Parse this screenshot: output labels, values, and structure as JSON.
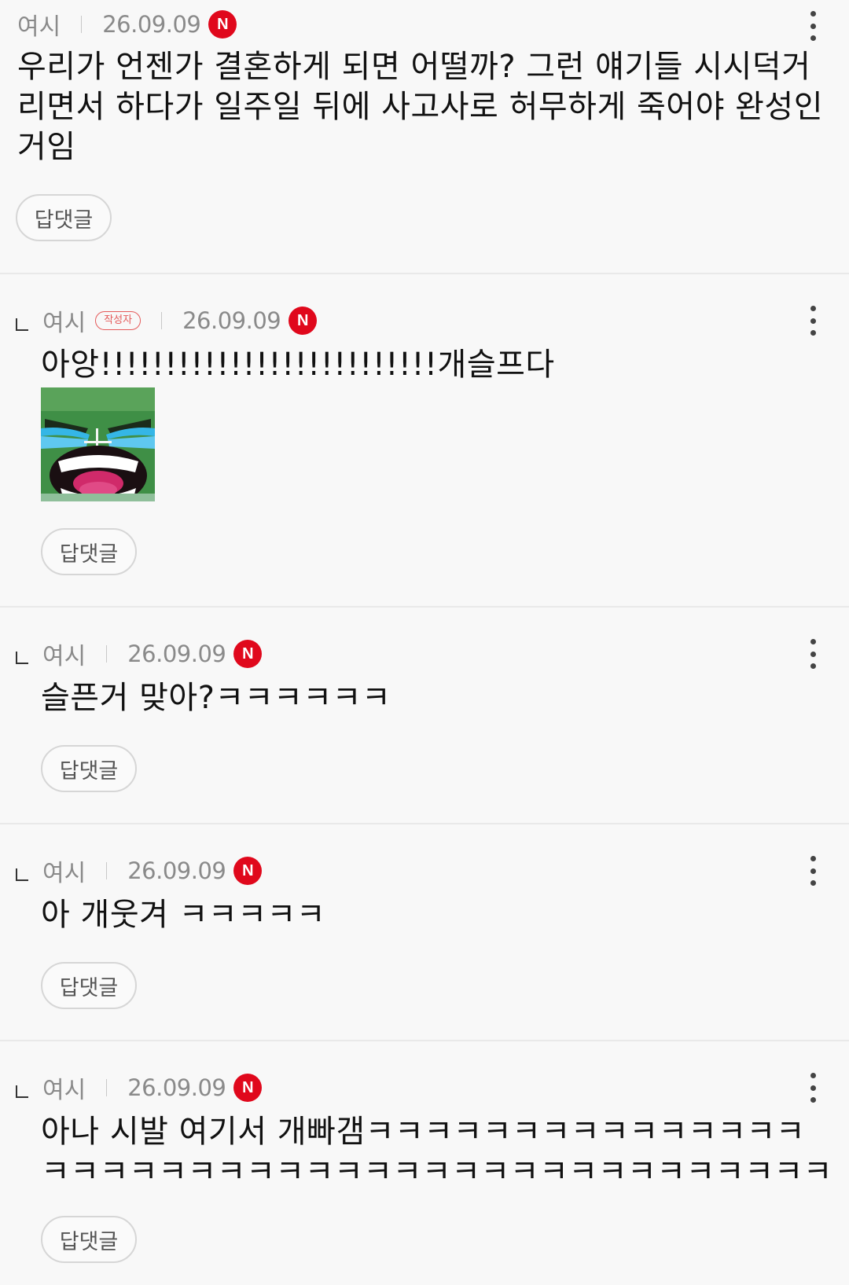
{
  "comments": [
    {
      "nick": "여시",
      "date": "26.09.09",
      "new_badge": "N",
      "body": "우리가 언젠가 결혼하게 되면 어떨까? 그런 얘기들 시시덕거리면서 하다가 일주일 뒤에 사고사로 허무하게 죽어야 완성인거임",
      "reply_label": "답댓글"
    },
    {
      "nick": "여시",
      "author_badge": "작성자",
      "date": "26.09.09",
      "new_badge": "N",
      "body": "아앙!!!!!!!!!!!!!!!!!!!!!!!!!!개슬프다",
      "sticker_icon": "crying-screaming-face-sticker",
      "reply_label": "답댓글"
    },
    {
      "nick": "여시",
      "date": "26.09.09",
      "new_badge": "N",
      "body": "슬픈거 맞아?ㅋㅋㅋㅋㅋㅋ",
      "reply_label": "답댓글"
    },
    {
      "nick": "여시",
      "date": "26.09.09",
      "new_badge": "N",
      "body": "아 개웃겨 ㅋㅋㅋㅋㅋ",
      "reply_label": "답댓글"
    },
    {
      "nick": "여시",
      "date": "26.09.09",
      "new_badge": "N",
      "body": "아나 시발 여기서 개빠갬ㅋㅋㅋㅋㅋㅋㅋㅋㅋㅋㅋㅋㅋㅋㅋㅋㅋㅋㅋㅋㅋㅋㅋㅋㅋㅋㅋㅋㅋㅋㅋㅋㅋㅋㅋㅋㅋㅋㅋㅋㅋㅋ",
      "reply_label": "답댓글"
    }
  ],
  "colors": {
    "new_badge": "#e0081c",
    "author_badge": "#e45a5a",
    "background": "#f8f8f8"
  }
}
